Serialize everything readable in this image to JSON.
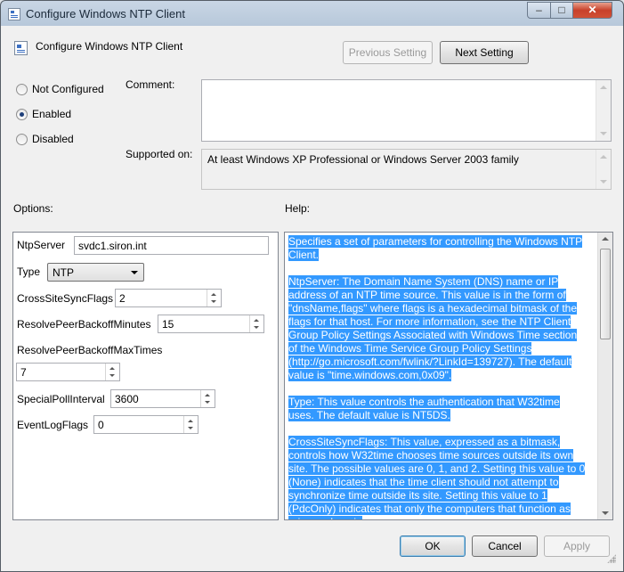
{
  "window": {
    "title": "Configure Windows NTP Client",
    "controls": {
      "minimize": "–",
      "maximize": "□",
      "close": "✕"
    }
  },
  "header": {
    "icon": "policy-setting-icon",
    "title": "Configure Windows NTP Client",
    "previous_setting": "Previous Setting",
    "next_setting": "Next Setting"
  },
  "state": {
    "options": [
      {
        "label": "Not Configured",
        "selected": false
      },
      {
        "label": "Enabled",
        "selected": true
      },
      {
        "label": "Disabled",
        "selected": false
      }
    ]
  },
  "comment": {
    "label": "Comment:",
    "value": ""
  },
  "supported": {
    "label": "Supported on:",
    "value": "At least Windows XP Professional or Windows Server 2003 family"
  },
  "options": {
    "heading": "Options:",
    "ntp_server": {
      "label": "NtpServer",
      "value": "svdc1.siron.int"
    },
    "type": {
      "label": "Type",
      "value": "NTP"
    },
    "cross_site_sync_flags": {
      "label": "CrossSiteSyncFlags",
      "value": "2"
    },
    "resolve_peer_backoff_minutes": {
      "label": "ResolvePeerBackoffMinutes",
      "value": "15"
    },
    "resolve_peer_backoff_max_times": {
      "label": "ResolvePeerBackoffMaxTimes",
      "value": "7"
    },
    "special_poll_interval": {
      "label": "SpecialPollInterval",
      "value": "3600"
    },
    "event_log_flags": {
      "label": "EventLogFlags",
      "value": "0"
    }
  },
  "help": {
    "heading": "Help:",
    "paragraphs": [
      "Specifies a set of parameters for controlling the Windows NTP Client.",
      "NtpServer: The Domain Name System (DNS) name or IP address of an NTP time source. This value is in the form of \"dnsName,flags\" where flags is a hexadecimal bitmask of the flags for that host. For more information, see the NTP Client Group Policy Settings Associated with Windows Time section of the Windows Time Service Group Policy Settings (http://go.microsoft.com/fwlink/?LinkId=139727). The default value is \"time.windows.com,0x09\".",
      "Type: This value controls the authentication that W32time uses. The default value is NT5DS.",
      "CrossSiteSyncFlags: This value, expressed as a bitmask, controls how W32time chooses time sources outside its own site. The possible values are 0, 1, and 2. Setting this value to 0 (None) indicates that the time client should not attempt to synchronize time outside its site. Setting this value to 1 (PdcOnly) indicates that only the computers that function as primary domain"
    ]
  },
  "footer": {
    "ok": "OK",
    "cancel": "Cancel",
    "apply": "Apply"
  },
  "colors": {
    "selection": "#3399ff",
    "title_close": "#c8412a",
    "default_button_border": "#3c7fb1"
  }
}
